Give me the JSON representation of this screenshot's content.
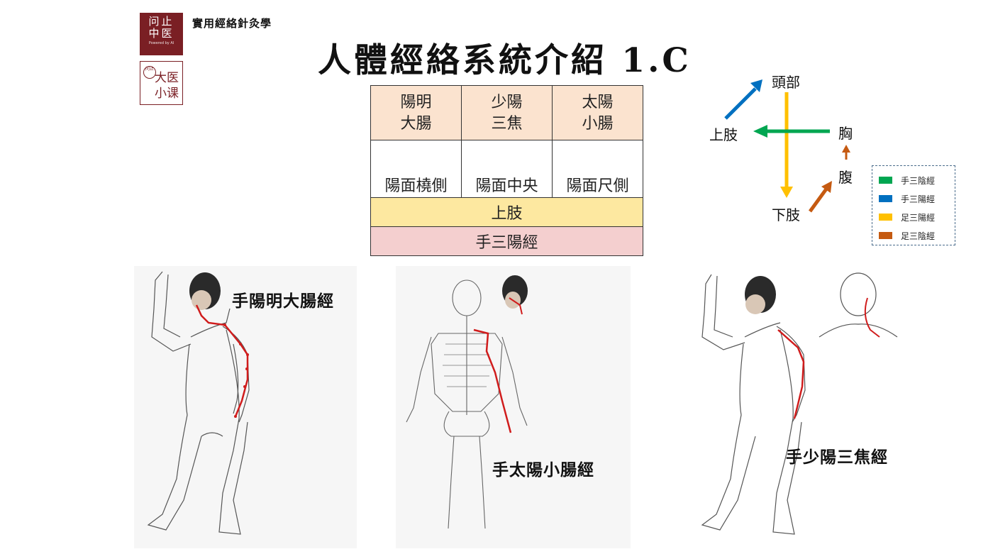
{
  "logo_primary": {
    "line1": "问止",
    "line2": "中医",
    "line3": "Powered by AI"
  },
  "logo_secondary": {
    "seal": "问止",
    "line1": "大医",
    "line2": "小课"
  },
  "course_title": "實用經絡針灸學",
  "slide_title": "人體經絡系統介紹 1.C",
  "meridian_table": {
    "organs": [
      "陽明\n大腸",
      "少陽\n三焦",
      "太陽\n小腸"
    ],
    "surfaces": [
      "陽面橈側",
      "陽面中央",
      "陽面尺側"
    ],
    "limb": "上肢",
    "group": "手三陽經"
  },
  "direction_diagram": {
    "top": "頭部",
    "left": "上肢",
    "right_upper": "胸",
    "right_lower": "腹",
    "bottom": "下肢"
  },
  "legend": [
    {
      "label": "手三陰經",
      "color": "#00a651"
    },
    {
      "label": "手三陽經",
      "color": "#0070c0"
    },
    {
      "label": "足三陽經",
      "color": "#ffc000"
    },
    {
      "label": "足三陰經",
      "color": "#c55a11"
    }
  ],
  "figures": [
    {
      "label": "手陽明大腸經"
    },
    {
      "label": "手太陽小腸經"
    },
    {
      "label": "手少陽三焦經"
    }
  ],
  "colors": {
    "brand": "#7a1f24",
    "meridian_path": "#d01c1c"
  }
}
